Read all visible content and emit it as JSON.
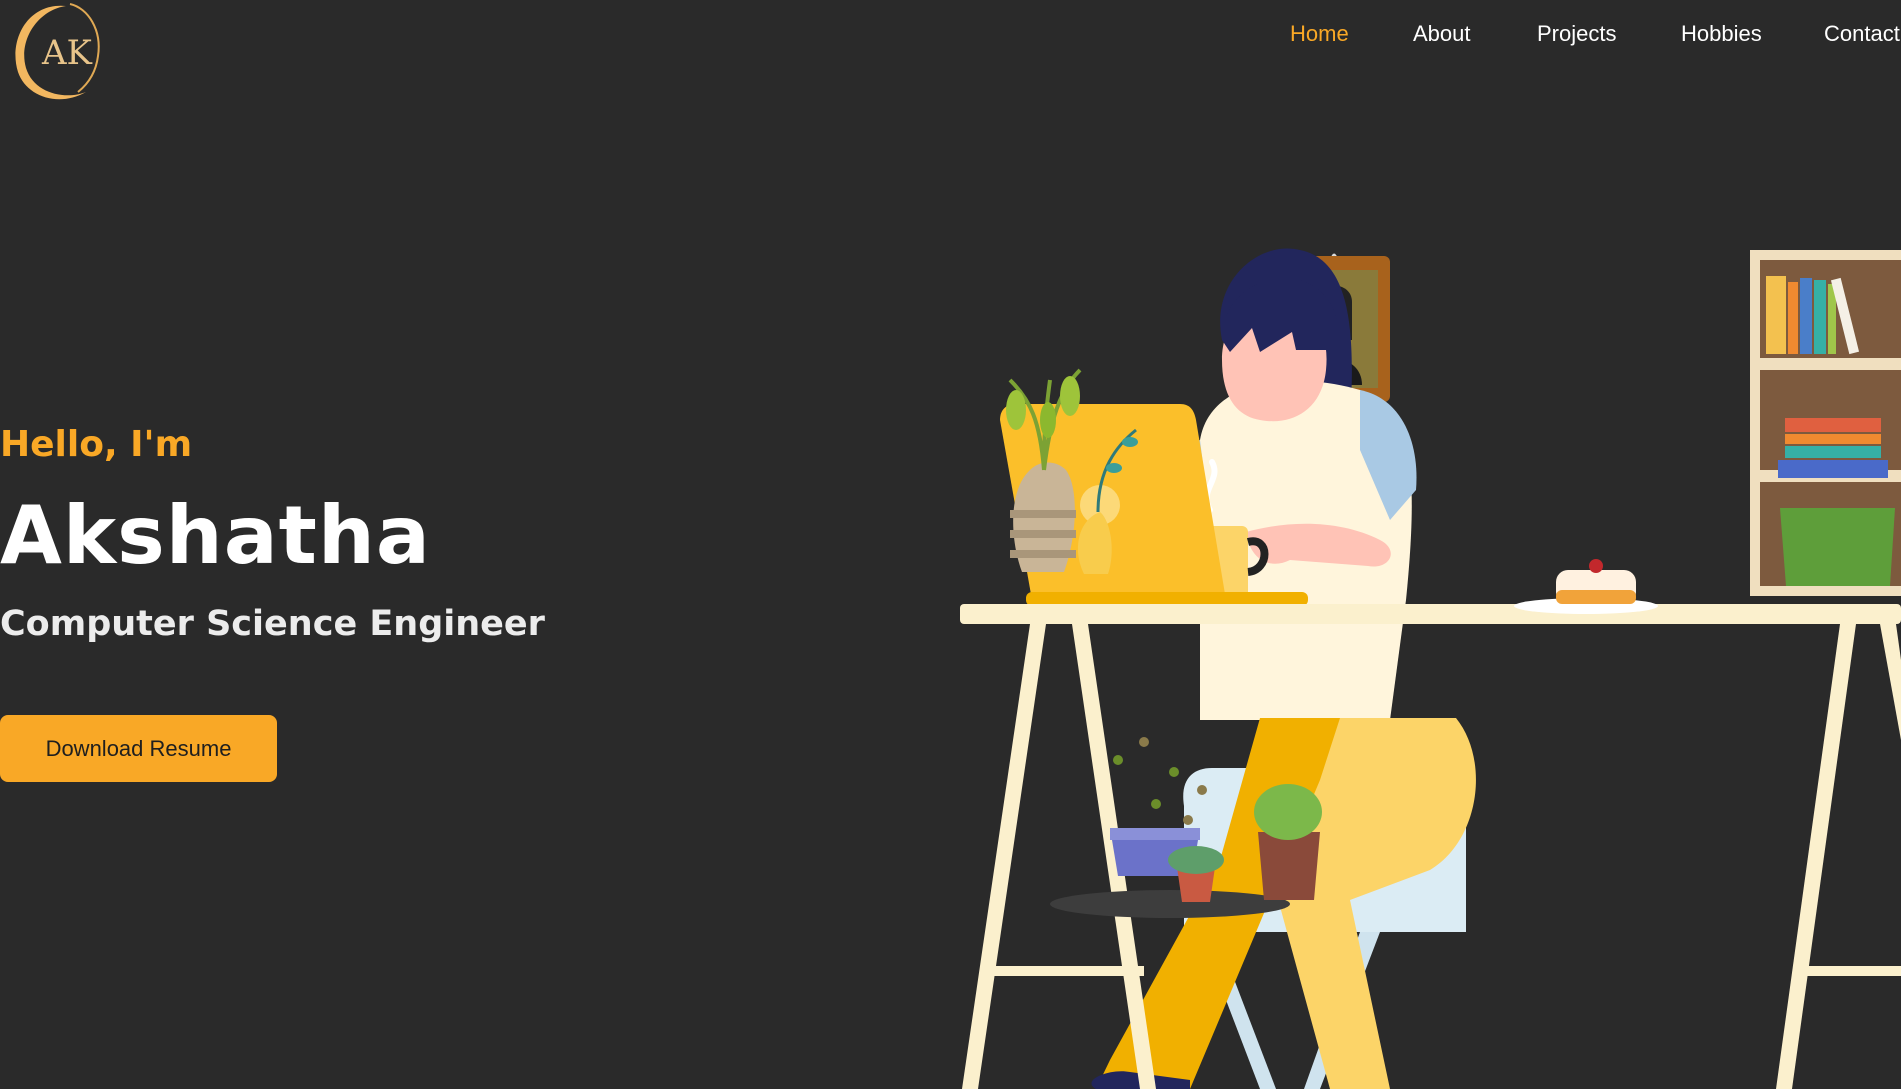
{
  "logo": {
    "initials": "AK",
    "accent_color": "#f9a826"
  },
  "nav": {
    "items": [
      {
        "label": "Home",
        "active": true
      },
      {
        "label": "About",
        "active": false
      },
      {
        "label": "Projects",
        "active": false
      },
      {
        "label": "Hobbies",
        "active": false
      },
      {
        "label": "Contact",
        "active": false
      }
    ]
  },
  "hero": {
    "greeting": "Hello, I'm",
    "name": "Akshatha",
    "role": "Computer Science Engineer",
    "button_label": "Download Resume"
  },
  "illustration": {
    "icon": "woman-at-desk-illustration"
  },
  "colors": {
    "background": "#2a2a2a",
    "accent": "#f9a826",
    "text": "#ffffff"
  }
}
